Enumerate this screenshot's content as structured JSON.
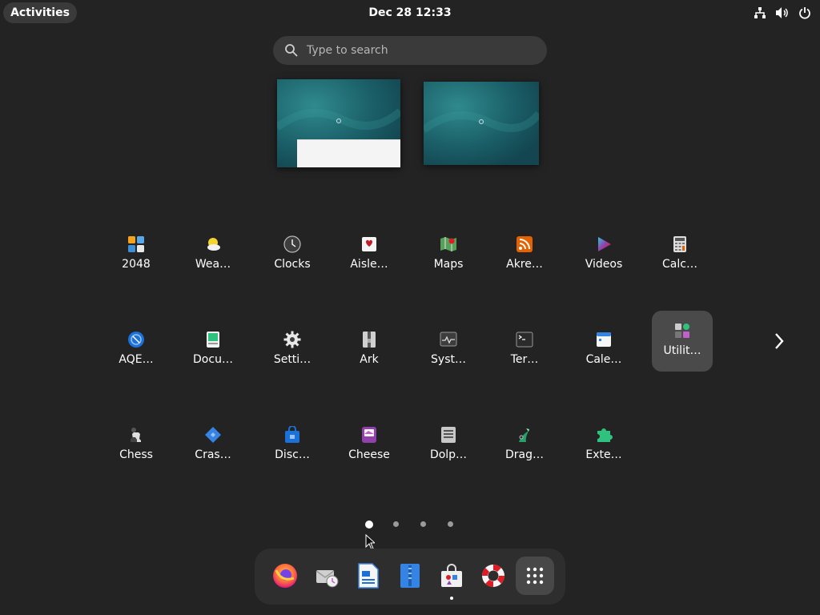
{
  "topbar": {
    "activities_label": "Activities",
    "clock": "Dec 28  12:33",
    "tray_icons": [
      "network-icon",
      "volume-icon",
      "power-icon"
    ]
  },
  "search": {
    "placeholder": "Type to search",
    "value": ""
  },
  "workspaces": [
    {
      "name": "workspace-1",
      "has_window": true
    },
    {
      "name": "workspace-2",
      "has_window": false
    }
  ],
  "app_grid": {
    "apps": [
      {
        "label": "2048",
        "icon": "2048-icon"
      },
      {
        "label": "Wea…",
        "icon": "weather-icon"
      },
      {
        "label": "Clocks",
        "icon": "clock-icon"
      },
      {
        "label": "Aisle…",
        "icon": "aisleriot-icon"
      },
      {
        "label": "Maps",
        "icon": "maps-icon"
      },
      {
        "label": "Akre…",
        "icon": "akregator-icon"
      },
      {
        "label": "Videos",
        "icon": "videos-icon"
      },
      {
        "label": "Calc…",
        "icon": "calculator-icon"
      },
      {
        "label": "AQE…",
        "icon": "aqemu-icon"
      },
      {
        "label": "Docu…",
        "icon": "document-viewer-icon"
      },
      {
        "label": "Setti…",
        "icon": "settings-gear-icon"
      },
      {
        "label": "Ark",
        "icon": "ark-archive-icon"
      },
      {
        "label": "Syst…",
        "icon": "system-monitor-icon"
      },
      {
        "label": "Ter…",
        "icon": "terminal-icon"
      },
      {
        "label": "Cale…",
        "icon": "calendar-icon"
      },
      {
        "label": "Utilit…",
        "icon": "utilities-folder-icon",
        "selected": true
      },
      {
        "label": "Chess",
        "icon": "chess-icon"
      },
      {
        "label": "Cras…",
        "icon": "crash-reporter-icon"
      },
      {
        "label": "Disc…",
        "icon": "discover-icon"
      },
      {
        "label": "Cheese",
        "icon": "cheese-icon"
      },
      {
        "label": "Dolp…",
        "icon": "dolphin-icon"
      },
      {
        "label": "Drag…",
        "icon": "dragon-player-icon"
      },
      {
        "label": "Exte…",
        "icon": "extensions-icon"
      }
    ],
    "page_count": 4,
    "current_page": 1
  },
  "dash": {
    "items": [
      {
        "name": "firefox",
        "icon": "firefox-icon",
        "running": false
      },
      {
        "name": "evolution-mail",
        "icon": "mail-clock-icon",
        "running": false
      },
      {
        "name": "libreoffice-writer",
        "icon": "writer-document-icon",
        "running": false
      },
      {
        "name": "text-editor",
        "icon": "text-editor-icon",
        "running": false
      },
      {
        "name": "software",
        "icon": "software-store-icon",
        "running": true
      },
      {
        "name": "help",
        "icon": "lifebuoy-icon",
        "running": false
      },
      {
        "name": "show-apps",
        "icon": "app-grid-icon",
        "running": false
      }
    ]
  },
  "colors": {
    "background": "#232323",
    "panel": "#3a3a3a",
    "dash": "#2e2e2e",
    "selected": "#4a4a4a",
    "wallpaper": "#1f5f66"
  }
}
